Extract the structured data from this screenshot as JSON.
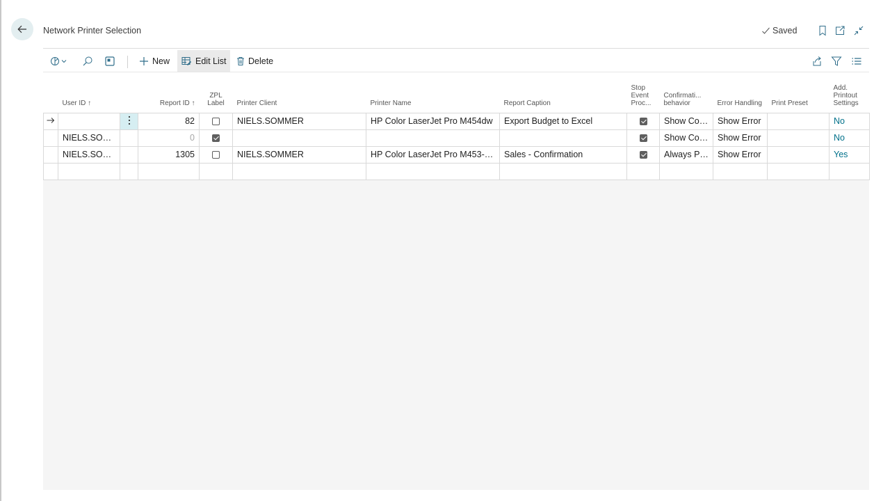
{
  "page": {
    "title": "Network Printer Selection",
    "saved_label": "Saved"
  },
  "icons": {
    "back": "arrow-left-icon",
    "saved_check": "check-icon",
    "bookmark": "bookmark-icon",
    "open_new_window": "open-new-window-icon",
    "collapse": "collapse-icon"
  },
  "toolbar": {
    "new_label": "New",
    "edit_list_label": "Edit List",
    "delete_label": "Delete"
  },
  "columns": [
    {
      "key": "user_id",
      "label": "User ID ↑"
    },
    {
      "key": "report_id",
      "label": "Report ID ↑"
    },
    {
      "key": "zpl_label",
      "label": "ZPL Label"
    },
    {
      "key": "printer_client",
      "label": "Printer Client"
    },
    {
      "key": "printer_name",
      "label": "Printer Name"
    },
    {
      "key": "report_caption",
      "label": "Report Caption"
    },
    {
      "key": "stop_event",
      "label": "Stop Event Proc..."
    },
    {
      "key": "confirmation",
      "label": "Confirmati... behavior"
    },
    {
      "key": "error_handling",
      "label": "Error Handling"
    },
    {
      "key": "print_preset",
      "label": "Print Preset"
    },
    {
      "key": "add_printout",
      "label": "Add. Printout Settings"
    }
  ],
  "rows": [
    {
      "user_id": "",
      "report_id": "82",
      "zpl_label": false,
      "printer_client": "NIELS.SOMMER",
      "printer_name": "HP Color LaserJet Pro M454dw",
      "report_caption": "Export Budget to Excel",
      "stop_event": true,
      "confirmation": "Show Confi...",
      "error_handling": "Show Error",
      "print_preset": "",
      "add_printout": "No"
    },
    {
      "user_id": "NIELS.SOMM...",
      "report_id": "0",
      "zpl_label": true,
      "printer_client": "",
      "printer_name": "",
      "report_caption": "",
      "stop_event": true,
      "confirmation": "Show Confi...",
      "error_handling": "Show Error",
      "print_preset": "",
      "add_printout": "No"
    },
    {
      "user_id": "NIELS.SOMM...",
      "report_id": "1305",
      "zpl_label": false,
      "printer_client": "NIELS.SOMMER",
      "printer_name": "HP Color LaserJet Pro M453-4 P...",
      "report_caption": "Sales - Confirmation",
      "stop_event": true,
      "confirmation": "Always Print",
      "error_handling": "Show Error",
      "print_preset": "",
      "add_printout": "Yes"
    }
  ],
  "colors": {
    "accent": "#00708a",
    "selected_cell": "#d6eef2",
    "back_button_bg": "#e3eef0"
  }
}
